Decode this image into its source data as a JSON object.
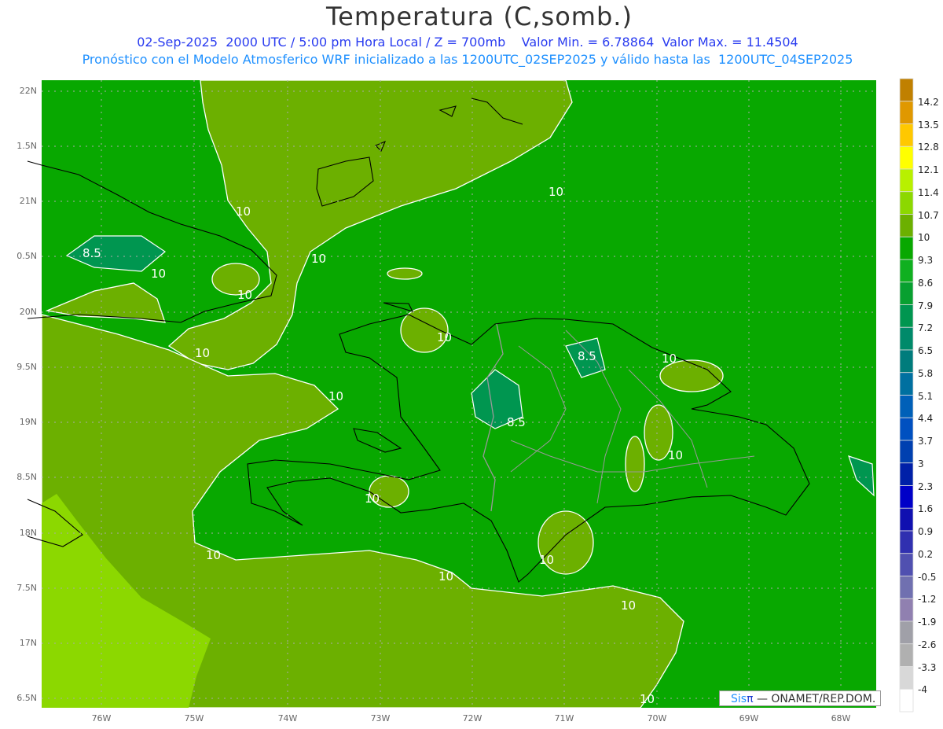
{
  "header": {
    "title": "Temperatura (C,somb.)",
    "line1": "02-Sep-2025  2000 UTC / 5:00 pm Hora Local / Z = 700mb    Valor Min. = 6.78864  Valor Max. = 11.4504",
    "line2": "Pronóstico con el Modelo Atmosferico WRF inicializado a las 1200UTC_02SEP2025 y válido hasta las  1200UTC_04SEP2025"
  },
  "axes": {
    "lat_labels": [
      "22N",
      "1.5N",
      "21N",
      "0.5N",
      "20N",
      "9.5N",
      "19N",
      "8.5N",
      "18N",
      "7.5N",
      "17N",
      "6.5N"
    ],
    "lon_labels": [
      "76W",
      "75W",
      "74W",
      "73W",
      "72W",
      "71W",
      "70W",
      "69W",
      "68W"
    ]
  },
  "colorbar": {
    "labels": [
      "14.2",
      "13.5",
      "12.8",
      "12.1",
      "11.4",
      "10.7",
      "10",
      "9.3",
      "8.6",
      "7.9",
      "7.2",
      "6.5",
      "5.8",
      "5.1",
      "4.4",
      "3.7",
      "3",
      "2.3",
      "1.6",
      "0.9",
      "0.2",
      "-0.5",
      "-1.2",
      "-1.9",
      "-2.6",
      "-3.3",
      "-4"
    ],
    "colors": [
      "#c08000",
      "#e09800",
      "#ffc800",
      "#ffff00",
      "#b8f000",
      "#8cd800",
      "#6cb000",
      "#08a800",
      "#10b020",
      "#08a030",
      "#009650",
      "#008a6a",
      "#007c7c",
      "#0070a0",
      "#0060b8",
      "#0050c0",
      "#0040b0",
      "#0020a8",
      "#0000c8",
      "#1010b0",
      "#3030b0",
      "#5050b0",
      "#7070b0",
      "#9080b0",
      "#a0a0a8",
      "#b0b0b0",
      "#d8d8d8",
      "#ffffff"
    ]
  },
  "contour_labels": [
    "10",
    "10",
    "10",
    "10",
    "10",
    "10",
    "10",
    "10",
    "10",
    "10",
    "10",
    "10",
    "10",
    "10",
    "10",
    "10",
    "8.5",
    "8.5",
    "8.5"
  ],
  "credit": {
    "sis": "Sis",
    "pi": "π",
    "text": " — ONAMET/REP.DOM."
  },
  "fill_colors": {
    "base": "#08a800",
    "olive": "#6cb000",
    "lime": "#8cd800",
    "dark": "#009650"
  }
}
